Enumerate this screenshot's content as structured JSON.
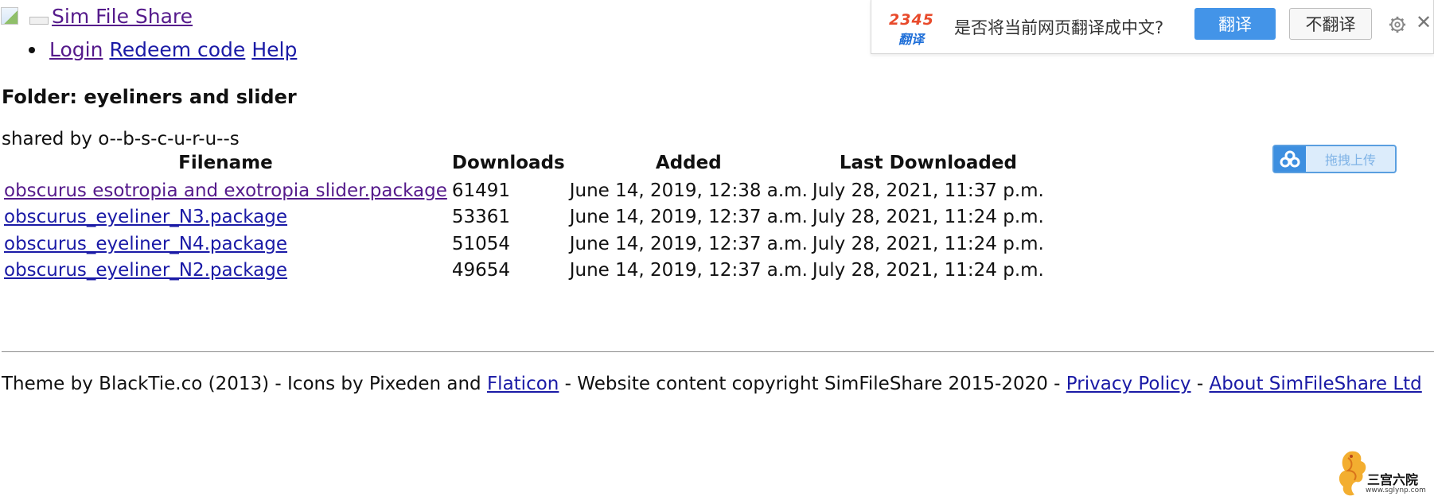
{
  "site": {
    "name": "Sim File Share"
  },
  "nav": {
    "items": [
      "Login",
      "Redeem code",
      "Help"
    ]
  },
  "folder": {
    "title": "Folder: eyeliners and slider",
    "shared_by": "shared by o--b-s-c-u-r-u--s"
  },
  "table": {
    "headers": [
      "Filename",
      "Downloads",
      "Added",
      "Last Downloaded"
    ],
    "rows": [
      {
        "filename": "obscurus esotropia and exotropia slider.package",
        "downloads": "61491",
        "added": "June 14, 2019, 12:38 a.m.",
        "last_downloaded": "July 28, 2021, 11:37 p.m.",
        "visited": true
      },
      {
        "filename": "obscurus_eyeliner_N3.package",
        "downloads": "53361",
        "added": "June 14, 2019, 12:37 a.m.",
        "last_downloaded": "July 28, 2021, 11:24 p.m.",
        "visited": false
      },
      {
        "filename": "obscurus_eyeliner_N4.package",
        "downloads": "51054",
        "added": "June 14, 2019, 12:37 a.m.",
        "last_downloaded": "July 28, 2021, 11:24 p.m.",
        "visited": false
      },
      {
        "filename": "obscurus_eyeliner_N2.package",
        "downloads": "49654",
        "added": "June 14, 2019, 12:37 a.m.",
        "last_downloaded": "July 28, 2021, 11:24 p.m.",
        "visited": false
      }
    ]
  },
  "footer": {
    "text_1": "Theme by BlackTie.co (2013) - Icons by Pixeden and ",
    "flaticon_link": "Flaticon",
    "text_2": " - Website content copyright SimFileShare 2015-2020 - ",
    "privacy_link": "Privacy Policy",
    "separator": " - ",
    "about_link": "About SimFileShare Ltd"
  },
  "translate_bar": {
    "logo_top": "2345",
    "logo_bottom": "翻译",
    "question": "是否将当前网页翻译成中文?",
    "translate_button": "翻译",
    "no_translate_button": "不翻译",
    "settings_icon": "gear-icon",
    "close_icon": "close-icon",
    "close_glyph": "✕"
  },
  "upload": {
    "label": "拖拽上传",
    "icon": "cloud-icon"
  },
  "watermark": {
    "text": "三宫六院",
    "url": "www.sglynp.com"
  },
  "colors": {
    "link": "#1a1aa6",
    "visited_link": "#551a8b",
    "translate_blue": "#4394e8",
    "logo_red": "#e84a2b",
    "logo_blue": "#1f6fd8",
    "upload_blue": "#3d8fe0"
  }
}
